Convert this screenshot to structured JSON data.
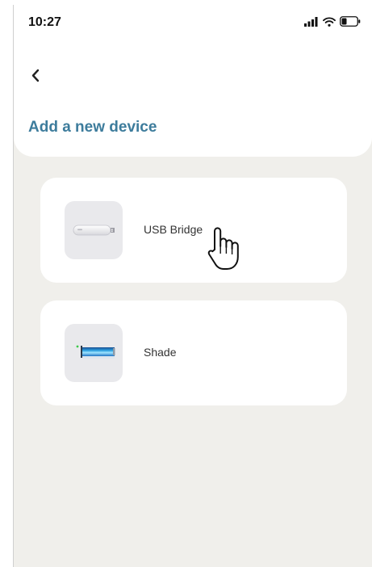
{
  "status_bar": {
    "time": "10:27",
    "icons": [
      "signal-icon",
      "wifi-icon",
      "battery-icon"
    ]
  },
  "header": {
    "back_icon": "chevron-left-icon",
    "title": "Add a new device"
  },
  "devices": [
    {
      "label": "USB Bridge",
      "icon": "usb-bridge-icon"
    },
    {
      "label": "Shade",
      "icon": "shade-motor-icon"
    }
  ],
  "colors": {
    "accent": "#3d7c9c",
    "background": "#f0efeb",
    "card": "#ffffff",
    "icon_tile": "#e9e9ec"
  }
}
